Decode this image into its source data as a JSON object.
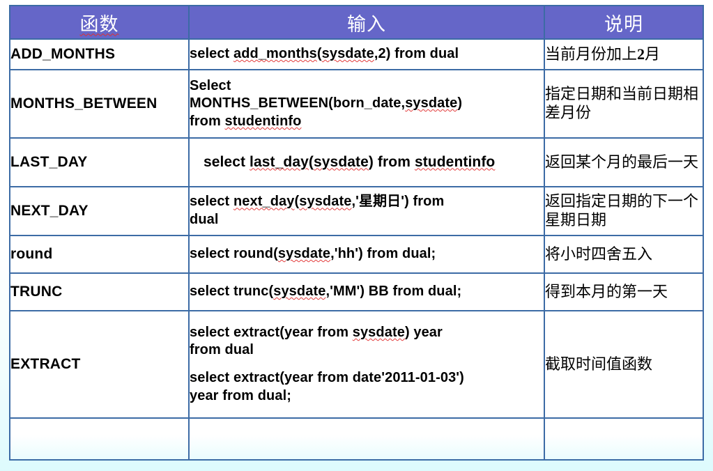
{
  "table": {
    "headers": [
      {
        "label": "函数",
        "misspelled": true
      },
      {
        "label": "输入",
        "misspelled": false
      },
      {
        "label": "说明",
        "misspelled": false
      }
    ],
    "rows": [
      {
        "function": "ADD_MONTHS",
        "input_lines": [
          "select add_months(sysdate,2) from dual"
        ],
        "description": "当前月份加上2月"
      },
      {
        "function": "MONTHS_BETWEEN",
        "input_lines": [
          "Select",
          "MONTHS_BETWEEN(born_date,sysdate)",
          "from studentinfo"
        ],
        "description": "指定日期和当前日期相差月份"
      },
      {
        "function": "LAST_DAY",
        "input_lines": [
          " select last_day(sysdate) from studentinfo"
        ],
        "description": "返回某个月的最后一天"
      },
      {
        "function": "NEXT_DAY",
        "input_lines": [
          "select next_day(sysdate,'星期日') from",
          "dual"
        ],
        "description": "返回指定日期的下一个星期日期"
      },
      {
        "function": "round",
        "input_lines": [
          "select round(sysdate,'hh') from dual;"
        ],
        "description": "将小时四舍五入"
      },
      {
        "function": "TRUNC",
        "input_lines": [
          "select trunc(sysdate,'MM') BB from dual;"
        ],
        "description": "得到本月的第一天"
      },
      {
        "function": "EXTRACT",
        "input_lines": [
          "select extract(year from sysdate) year",
          "from dual",
          "select extract(year from date'2011-01-03')",
          "year from dual;"
        ],
        "description": "截取时间值函数"
      },
      {
        "function": "",
        "input_lines": [
          ""
        ],
        "description": ""
      }
    ]
  },
  "colors": {
    "header_background": "#6566C8",
    "header_text": "#FFFFFF",
    "border": "#3C6BA5",
    "cell_background": "#FFFFFF",
    "page_background": "#DDFBFD",
    "spellcheck_underline": "#E23B3B"
  }
}
